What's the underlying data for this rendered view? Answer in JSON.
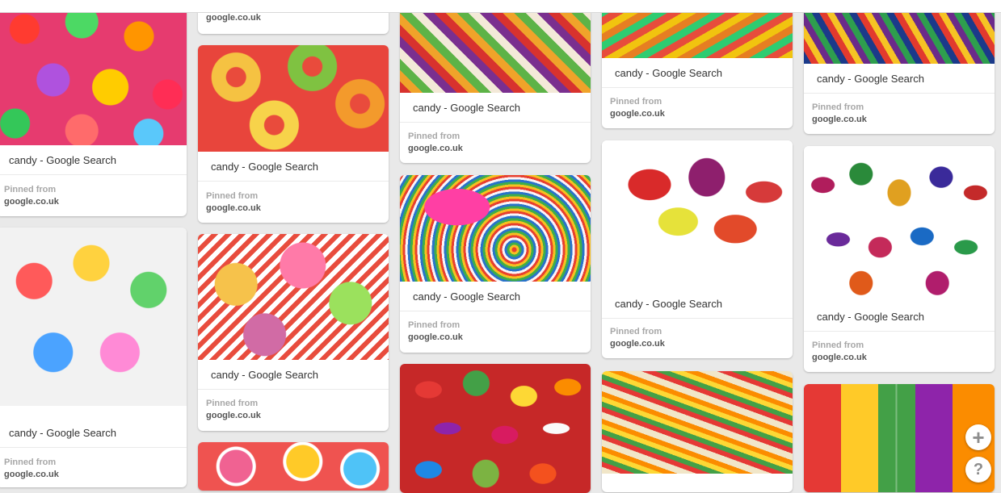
{
  "pins": [
    {
      "title": "candy - Google Search",
      "pinned_from": "Pinned from",
      "source": "google.co.uk"
    },
    {
      "title": "candy - Google Search",
      "pinned_from": "Pinned from",
      "source": "google.co.uk"
    },
    {
      "title": "",
      "pinned_from": "",
      "source": "google.co.uk"
    },
    {
      "title": "candy - Google Search",
      "pinned_from": "Pinned from",
      "source": "google.co.uk"
    },
    {
      "title": "candy - Google Search",
      "pinned_from": "Pinned from",
      "source": "google.co.uk"
    },
    {
      "title": "candy - Google Search",
      "pinned_from": "Pinned from",
      "source": "google.co.uk"
    },
    {
      "title": "candy - Google Search",
      "pinned_from": "Pinned from",
      "source": "google.co.uk"
    },
    {
      "title": "candy - Google Search",
      "pinned_from": "Pinned from",
      "source": "google.co.uk"
    },
    {
      "title": "candy - Google Search",
      "pinned_from": "Pinned from",
      "source": "google.co.uk"
    },
    {
      "title": "candy - Google Search",
      "pinned_from": "Pinned from",
      "source": "google.co.uk"
    },
    {
      "title": "candy - Google Search",
      "pinned_from": "Pinned from",
      "source": "google.co.uk"
    }
  ],
  "buttons": {
    "add_icon": "plus-icon",
    "add_label": "+",
    "help_icon": "question-mark-icon",
    "help_label": "?"
  },
  "colors": {
    "background": "#e9e9e9",
    "card": "#ffffff",
    "title_text": "#333333",
    "source_text": "#555555",
    "pinned_from_text": "#a7a7a7"
  }
}
